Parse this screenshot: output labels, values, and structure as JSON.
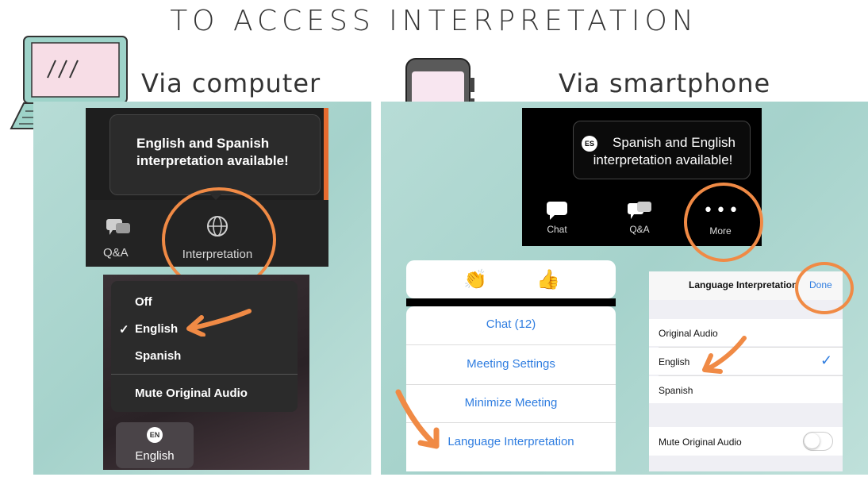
{
  "title": "TO ACCESS INTERPRETATION",
  "computer": {
    "heading": "Via computer",
    "tooltip": "English and Spanish interpretation available!",
    "toolbar": {
      "qa_label": "Q&A",
      "interpretation_label": "Interpretation"
    },
    "menu": {
      "items": [
        "Off",
        "English",
        "Spanish",
        "Mute Original Audio"
      ],
      "selected": "English",
      "check": "✓"
    },
    "badge": {
      "code": "EN",
      "label": "English"
    }
  },
  "smartphone": {
    "heading": "Via smartphone",
    "tooltip": {
      "code": "ES",
      "text": "Spanish and English interpretation available!"
    },
    "toolbar": {
      "chat_label": "Chat",
      "qa_label": "Q&A",
      "more_label": "More"
    },
    "reactions": [
      "👏",
      "👍"
    ],
    "menu": {
      "items": [
        "Chat (12)",
        "Meeting Settings",
        "Minimize Meeting",
        "Language Interpretation"
      ]
    },
    "language_panel": {
      "title": "Language Interpretation",
      "done": "Done",
      "options": [
        "Original Audio",
        "English",
        "Spanish"
      ],
      "selected": "English",
      "check": "✓",
      "mute_label": "Mute Original Audio"
    }
  },
  "colors": {
    "accent": "#f08a45",
    "ios_blue": "#2f7de0",
    "zoom_orange": "#e66b2f",
    "panel_teal": "#a5d2cb"
  }
}
